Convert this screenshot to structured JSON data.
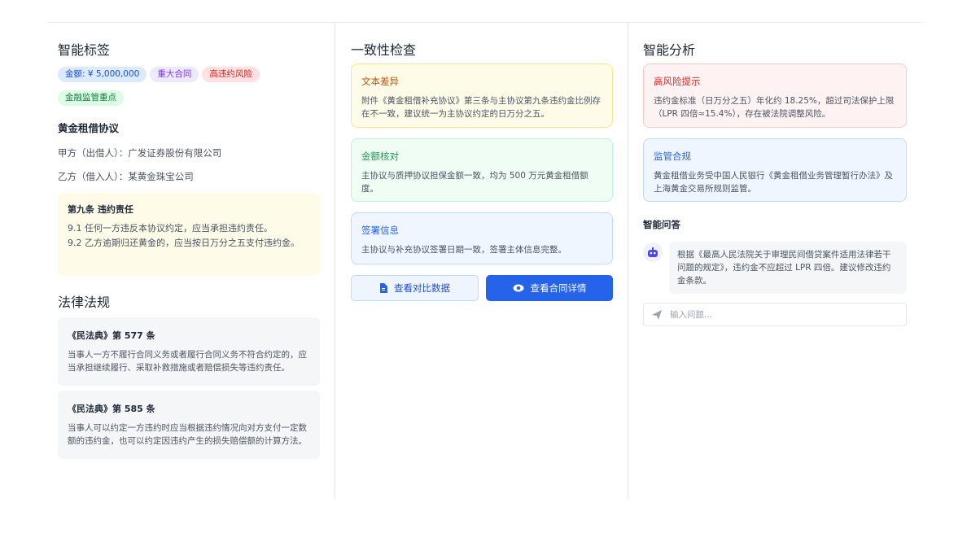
{
  "tags_panel": {
    "title": "智能标签",
    "tags": [
      {
        "label": "金额: ¥ 5,000,000",
        "color": "blue"
      },
      {
        "label": "重大合同",
        "color": "purple"
      },
      {
        "label": "高违约风险",
        "color": "red"
      },
      {
        "label": "金融监管重点",
        "color": "green"
      }
    ],
    "contract_title": "黄金租借协议",
    "party_a": "甲方（出借人）：广发证券股份有限公司",
    "party_b": "乙方（借入人）：某黄金珠宝公司",
    "clause": {
      "title": "第九条 违约责任",
      "lines": [
        "9.1 任何一方违反本协议约定，应当承担违约责任。",
        "9.2 乙方逾期归还黄金的，应当按日万分之五支付违约金。"
      ]
    },
    "laws_title": "法律法规",
    "laws": [
      {
        "title": "《民法典》第 577 条",
        "body": "当事人一方不履行合同义务或者履行合同义务不符合约定的，应当承担继续履行、采取补救措施或者赔偿损失等违约责任。"
      },
      {
        "title": "《民法典》第 585 条",
        "body": "当事人可以约定一方违约时应当根据违约情况向对方支付一定数额的违约金，也可以约定因违约产生的损失赔偿额的计算方法。"
      }
    ]
  },
  "consistency": {
    "title": "一致性检查",
    "cards": [
      {
        "title": "文本差异",
        "body": "附件《黄金租借补充协议》第三条与主协议第九条违约金比例存在不一致，建议统一为主协议约定的日万分之五。",
        "color": "yellow"
      },
      {
        "title": "金额核对",
        "body": "主协议与质押协议担保金额一致，均为 500 万元黄金租借额度。",
        "color": "green"
      },
      {
        "title": "签署信息",
        "body": "主协议与补充协议签署日期一致，签署主体信息完整。",
        "color": "blue"
      }
    ],
    "btn_compare": "查看对比数据",
    "btn_detail": "查看合同详情"
  },
  "analysis": {
    "title": "智能分析",
    "cards": [
      {
        "title": "高风险提示",
        "body": "违约金标准（日万分之五）年化约 18.25%，超过司法保护上限（LPR 四倍≈15.4%），存在被法院调整风险。",
        "color": "red"
      },
      {
        "title": "监管合规",
        "body": "黄金租借业务受中国人民银行《黄金租借业务管理暂行办法》及上海黄金交易所规则监管。",
        "color": "blue"
      }
    ],
    "qa_title": "智能问答",
    "qa_answer": "根据《最高人民法院关于审理民间借贷案件适用法律若干问题的规定》，违约金不应超过 LPR 四倍。建议修改违约金条款。",
    "qa_placeholder": "输入问题..."
  },
  "colors": {
    "primary": "#2563eb",
    "red": "#dc2626",
    "green": "#16a34a",
    "amber": "#b45309"
  }
}
